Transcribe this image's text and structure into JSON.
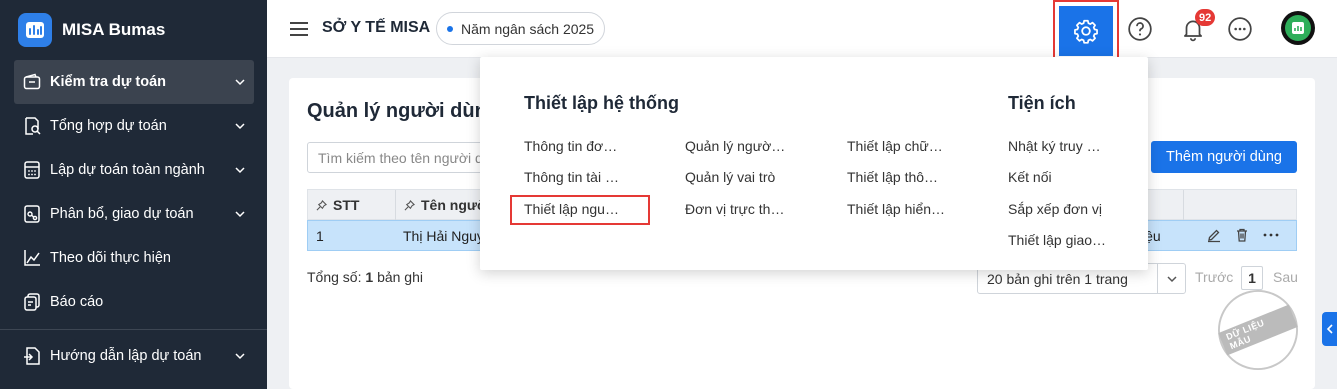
{
  "brand": {
    "name": "MISA Bumas",
    "logo_icon": "misa-logo-icon"
  },
  "sidebar": {
    "items": [
      {
        "label": "Kiểm tra dự toán",
        "icon": "wallet-icon",
        "has_chevron": true,
        "active": true
      },
      {
        "label": "Tổng hợp dự toán",
        "icon": "document-search-icon",
        "has_chevron": true
      },
      {
        "label": "Lập dự toán toàn ngành",
        "icon": "calculator-icon",
        "has_chevron": true
      },
      {
        "label": "Phân bổ, giao dự toán",
        "icon": "share-document-icon",
        "has_chevron": true
      },
      {
        "label": "Theo dõi thực hiện",
        "icon": "line-chart-icon",
        "has_chevron": false
      },
      {
        "label": "Báo cáo",
        "icon": "report-icon",
        "has_chevron": false
      },
      {
        "label": "Hướng dẫn lập dự toán",
        "icon": "guide-icon",
        "has_chevron": true
      }
    ]
  },
  "header": {
    "org_name": "SỞ Y TẾ MISA",
    "year_chip": "Năm ngân sách 2025",
    "notification_count": "92"
  },
  "main": {
    "title": "Quản lý người dùn",
    "search_placeholder": "Tìm kiếm theo tên người d",
    "add_button": "Thêm người dùng",
    "columns": [
      "STT",
      "Tên người"
    ],
    "rows": [
      {
        "stt": "1",
        "name": "Thị Hải Nguy",
        "status": "iệu"
      }
    ],
    "total_label": "Tổng số:",
    "total_count": "1",
    "total_suffix": "bản ghi",
    "page_size": "20 bản ghi trên 1 trang",
    "prev": "Trước",
    "page": "1",
    "next": "Sau",
    "watermark": "DỮ LIỆU MẪU"
  },
  "dropdown": {
    "system_heading": "Thiết lập hệ thống",
    "utility_heading": "Tiện ích",
    "col1": [
      "Thông tin đơ…",
      "Thông tin tài …",
      "Thiết lập ngu…"
    ],
    "col2": [
      "Quản lý ngườ…",
      "Quản lý vai trò",
      "Đơn vị trực th…"
    ],
    "col3": [
      "Thiết lập chữ…",
      "Thiết lập thô…",
      "Thiết lập hiển…"
    ],
    "utilities": [
      "Nhật ký truy …",
      "Kết nối",
      "Sắp xếp đơn vị",
      "Thiết lập giao…"
    ]
  },
  "colors": {
    "sidebar_bg": "#1f2937",
    "accent": "#1a73e8",
    "highlight": "#e53935",
    "row_selected": "#c7e3fb"
  }
}
